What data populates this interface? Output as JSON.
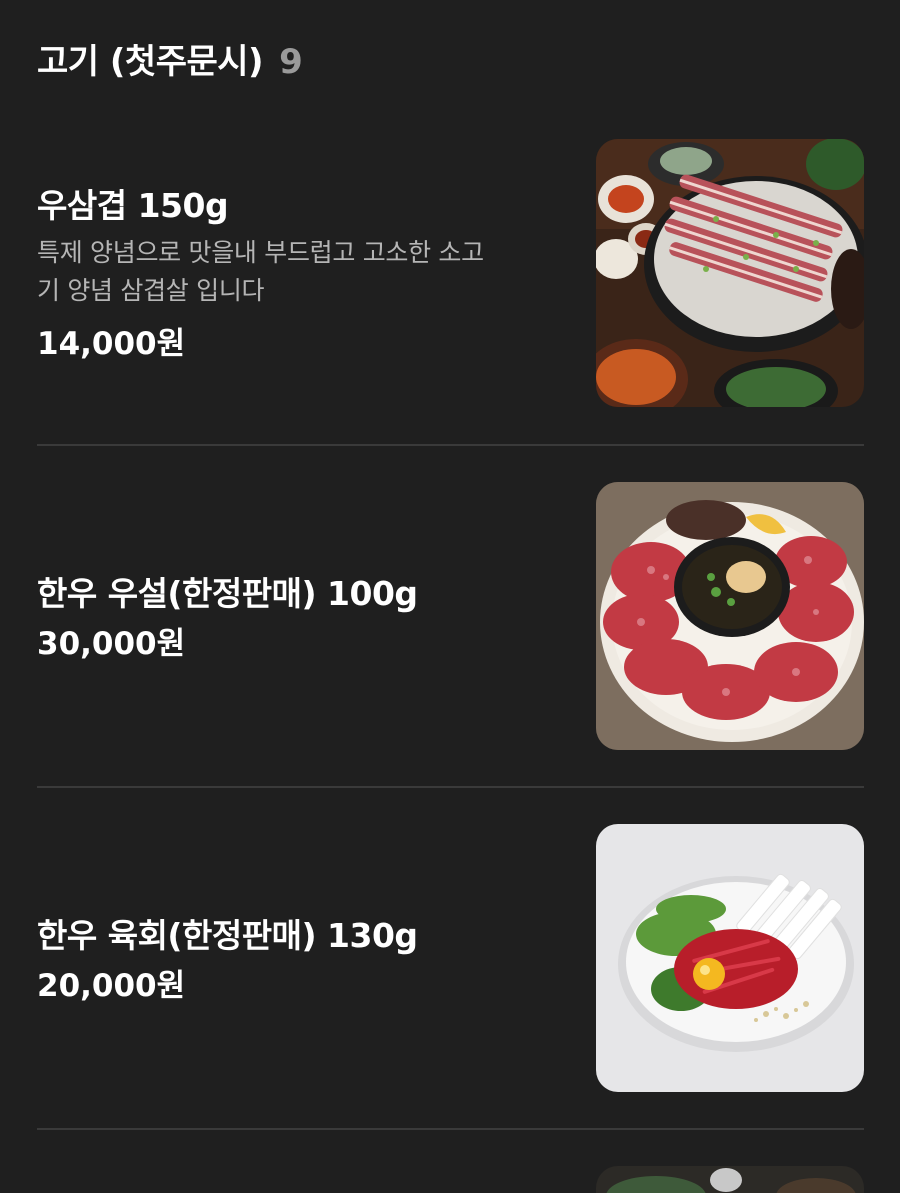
{
  "section": {
    "title": "고기 (첫주문시)",
    "count": "9"
  },
  "items": [
    {
      "name": "우삼겹 150g",
      "description_line1": "특제 양념으로 맛을내 부드럽고 고소한 소고",
      "description_line2": "기 양념 삼겹살 입니다",
      "price": "14,000원",
      "image": "grilled-beef-brisket-photo"
    },
    {
      "name": "한우 우설(한정판매) 100g",
      "price": "30,000원",
      "image": "beef-tongue-platter-photo"
    },
    {
      "name": "한우 육회(한정판매) 130g",
      "price": "20,000원",
      "image": "beef-tartare-photo"
    }
  ]
}
